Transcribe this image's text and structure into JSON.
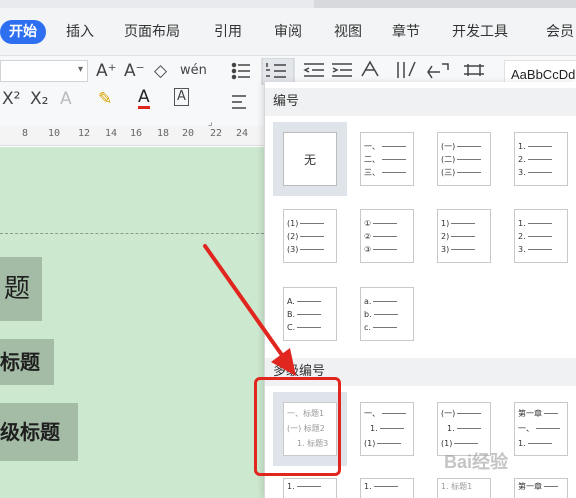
{
  "menu": {
    "tabs": [
      "开始",
      "插入",
      "页面布局",
      "引用",
      "审阅",
      "视图",
      "章节",
      "开发工具",
      "会员"
    ]
  },
  "ribbon": {
    "row1_icons": [
      "A⁺",
      "A⁻",
      "◇",
      "wén"
    ],
    "row2_icons": [
      "X²",
      "X₂",
      "A",
      "✎",
      "A",
      "A"
    ],
    "style_preview": "AaBbCcDd"
  },
  "ruler": {
    "ticks": [
      "8",
      "10",
      "12",
      "14",
      "16",
      "18",
      "20",
      "22",
      "24"
    ]
  },
  "document": {
    "heading1": "题",
    "heading2": "标题",
    "heading3": "级标题"
  },
  "numbering_panel": {
    "section_numbering": "编号",
    "section_multilevel": "多级编号",
    "none_label": "无",
    "tiles_row1": [
      [
        "一、",
        "二、",
        "三、"
      ],
      [
        "(一)",
        "(二)",
        "(三)"
      ],
      [
        "1.",
        "2.",
        "3."
      ]
    ],
    "tiles_row2": [
      [
        "(1)",
        "(2)",
        "(3)"
      ],
      [
        "①",
        "②",
        "③"
      ],
      [
        "1)",
        "2)",
        "3)"
      ],
      [
        "1.",
        "2.",
        "3."
      ]
    ],
    "tiles_row3": [
      [
        "A.",
        "B.",
        "C."
      ],
      [
        "a.",
        "b.",
        "c."
      ]
    ],
    "multilevel_tiles": [
      [
        "一、标题1",
        "(一) 标题2",
        "1. 标题3"
      ],
      [
        "一、",
        "1.",
        "(1)"
      ],
      [
        "(一)",
        "1.",
        "(1)"
      ],
      [
        "第一章",
        "一、",
        "1."
      ]
    ],
    "multilevel_row2": [
      [
        "1."
      ],
      [
        "1."
      ],
      [
        "1. 标题1"
      ],
      [
        "第一章"
      ]
    ]
  },
  "annotation": {
    "arrow_color": "#e0261f"
  },
  "watermark": "Bai经验"
}
